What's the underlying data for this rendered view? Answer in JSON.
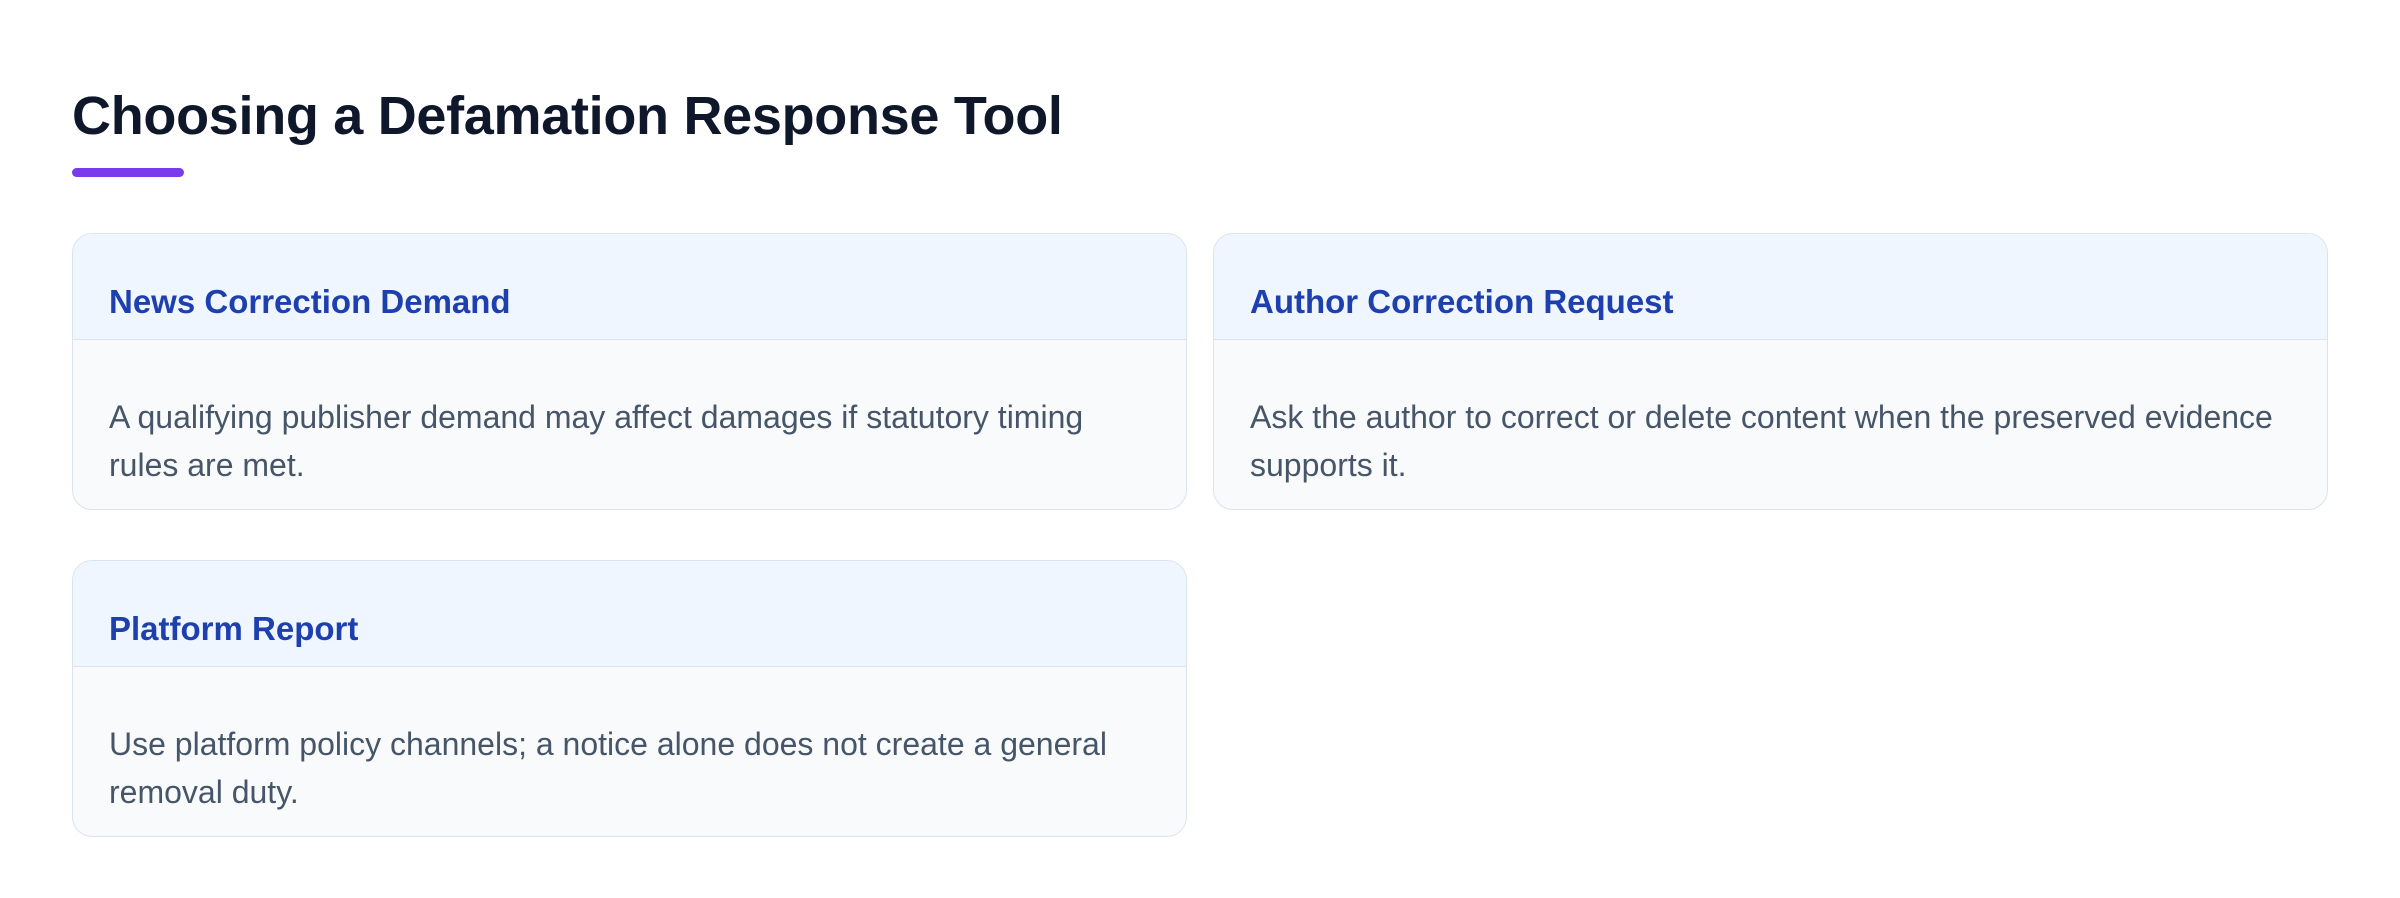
{
  "page": {
    "title": "Choosing a Defamation Response Tool"
  },
  "theme": {
    "accent": "#7c3aed",
    "card_title_color": "#1e40af",
    "card_header_bg": "#eff6ff",
    "card_body_bg": "#f8fafc",
    "title_color": "#0f172a",
    "body_text_color": "#475569"
  },
  "cards": [
    {
      "title": "News Correction Demand",
      "body": "A qualifying publisher demand may affect damages if statutory timing rules are met."
    },
    {
      "title": "Author Correction Request",
      "body": "Ask the author to correct or delete content when the preserved evidence supports it."
    },
    {
      "title": "Platform Report",
      "body": "Use platform policy channels; a notice alone does not create a general removal duty."
    }
  ]
}
